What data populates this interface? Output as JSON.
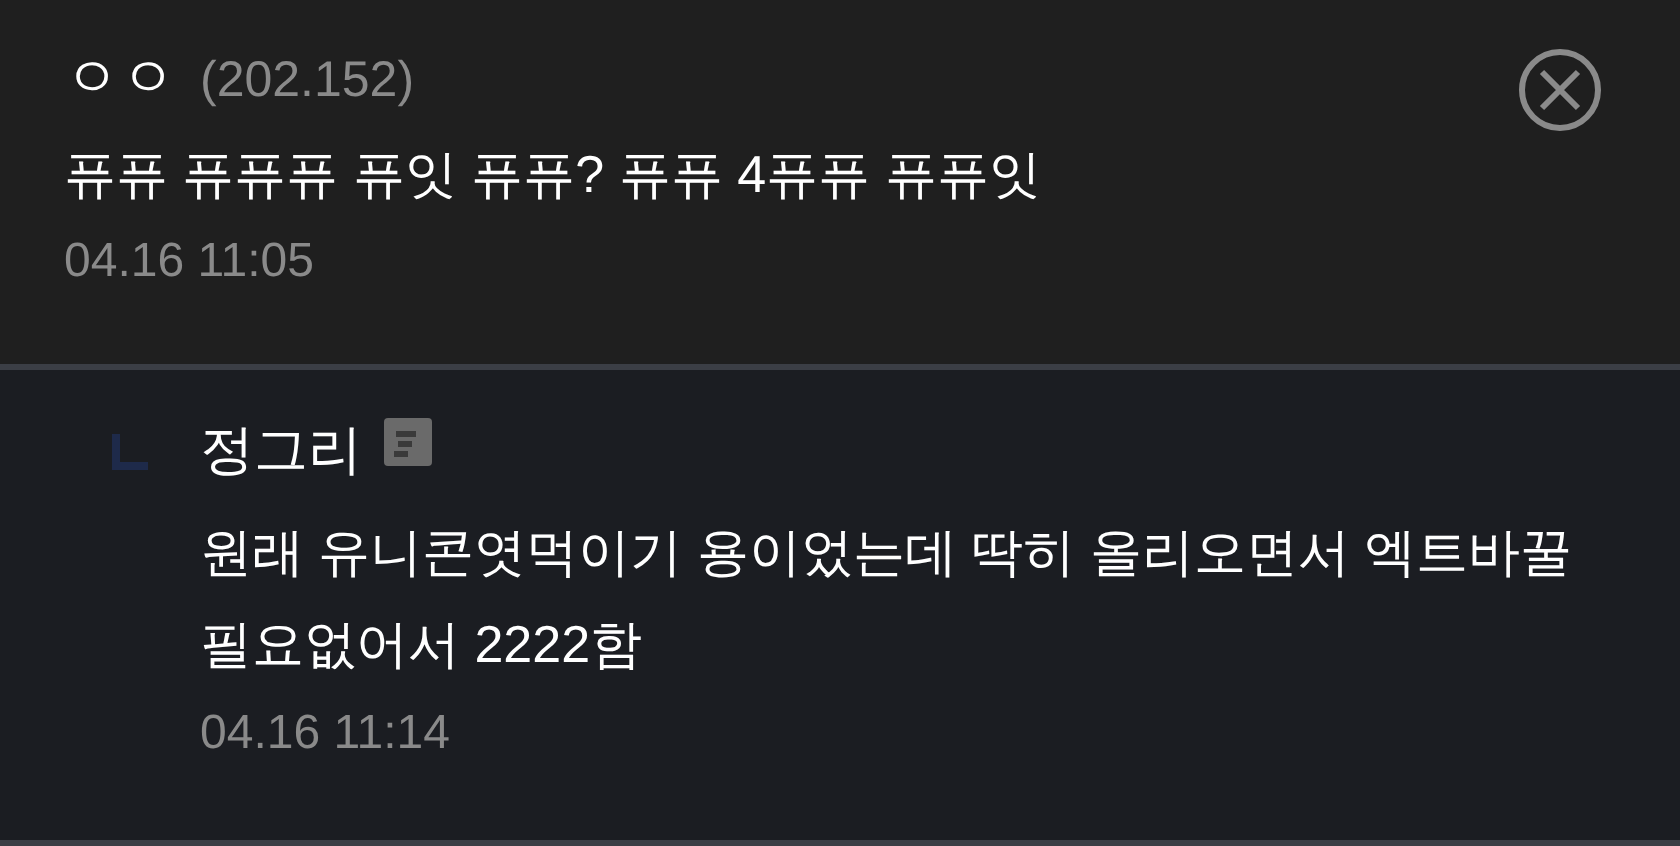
{
  "comment": {
    "author": "ㅇㅇ",
    "ip": "(202.152)",
    "text": "퓨퓨 퓨퓨퓨 퓨잇 퓨퓨? 퓨퓨 4퓨퓨 퓨퓨잇",
    "date": "04.16 11:05"
  },
  "reply": {
    "author": "정그리",
    "text": "원래 유니콘엿먹이기 용이었는데 딱히 올리오면서 엑트바꿀필요없어서 2222함",
    "date": "04.16 11:14"
  }
}
